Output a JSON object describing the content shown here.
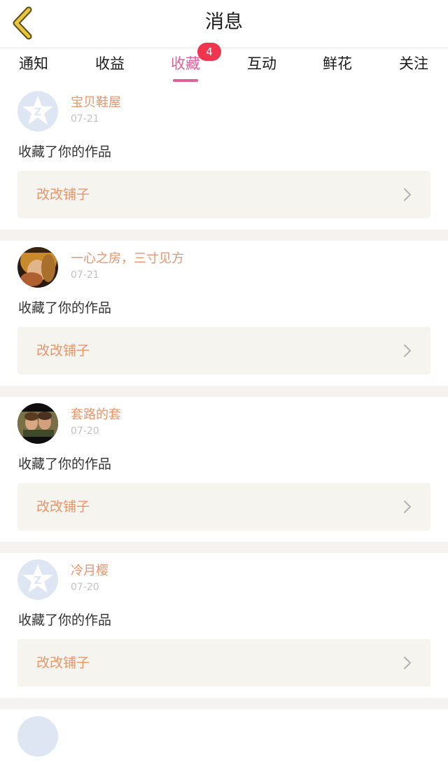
{
  "header": {
    "title": "消息",
    "back_icon": "chevron-left-icon",
    "accent_color": "#e8c53a"
  },
  "tabs": [
    {
      "label": "通知",
      "active": false
    },
    {
      "label": "收益",
      "active": false
    },
    {
      "label": "收藏",
      "active": true,
      "badge": "4"
    },
    {
      "label": "互动",
      "active": false
    },
    {
      "label": "鲜花",
      "active": false
    },
    {
      "label": "关注",
      "active": false
    }
  ],
  "colors": {
    "active_tab": "#e0609a",
    "badge": "#f0354e",
    "username": "#e8956a",
    "card_box": "#f5f4ef"
  },
  "messages": [
    {
      "user": "宝贝鞋屋",
      "date": "07-21",
      "action": "收藏了你的作品",
      "work": "改改铺子",
      "avatar": "default-avatar-icon"
    },
    {
      "user": "一心之房，三寸见方",
      "date": "07-21",
      "action": "收藏了你的作品",
      "work": "改改铺子",
      "avatar": "user-photo-avatar"
    },
    {
      "user": "套路的套",
      "date": "07-20",
      "action": "收藏了你的作品",
      "work": "改改铺子",
      "avatar": "user-photo-avatar"
    },
    {
      "user": "冷月樱",
      "date": "07-20",
      "action": "收藏了你的作品",
      "work": "改改铺子",
      "avatar": "default-avatar-icon"
    }
  ]
}
